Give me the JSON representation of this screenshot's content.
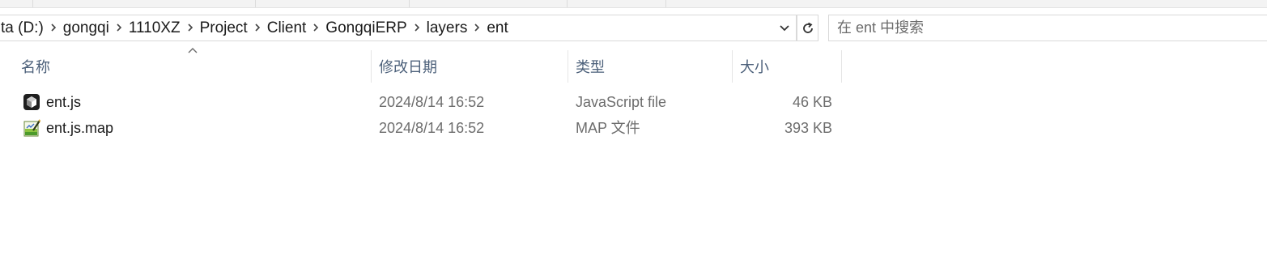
{
  "address_bar": {
    "segments": [
      "ta (D:)",
      "gongqi",
      "1110XZ",
      "Project",
      "Client",
      "GongqiERP",
      "layers",
      "ent"
    ]
  },
  "search": {
    "placeholder": "在 ent 中搜索"
  },
  "columns": {
    "name": "名称",
    "date": "修改日期",
    "type": "类型",
    "size": "大小"
  },
  "files": [
    {
      "name": "ent.js",
      "date": "2024/8/14 16:52",
      "type": "JavaScript file",
      "size": "46 KB",
      "icon": "javascript-file-icon"
    },
    {
      "name": "ent.js.map",
      "date": "2024/8/14 16:52",
      "type": "MAP 文件",
      "size": "393 KB",
      "icon": "map-file-icon"
    }
  ]
}
